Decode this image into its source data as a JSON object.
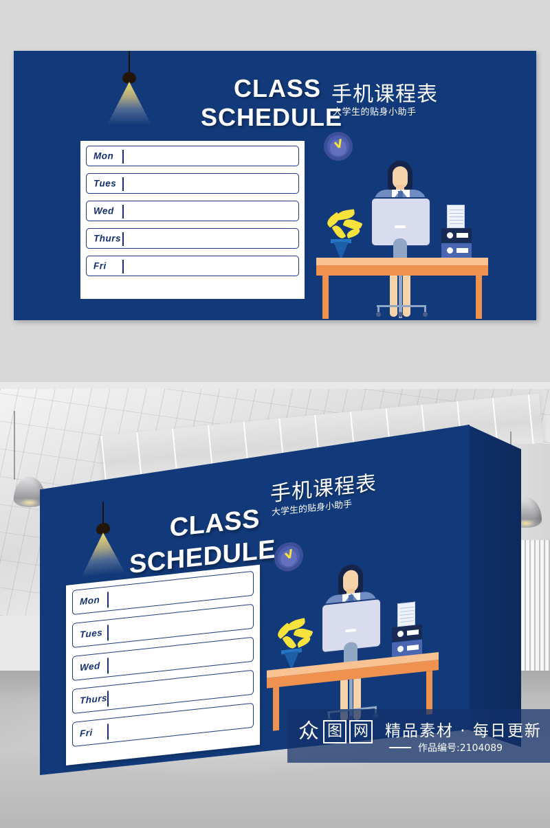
{
  "banner": {
    "english_title_line1": "CLASS",
    "english_title_line2": "SCHEDULE",
    "chinese_title": "手机课程表",
    "chinese_subtitle": "大学生的贴身小助手",
    "background_color": "#123A7A",
    "accent_white": "#FFFFFF",
    "label_color": "#14306E"
  },
  "schedule": {
    "rows": [
      {
        "day": "Mon",
        "value": ""
      },
      {
        "day": "Tues",
        "value": ""
      },
      {
        "day": "Wed",
        "value": ""
      },
      {
        "day": "Thurs",
        "value": ""
      },
      {
        "day": "Fri",
        "value": ""
      }
    ]
  },
  "illustration": {
    "clock": "wall-clock",
    "person": "woman-at-desk",
    "monitor": "desktop-monitor",
    "plant": "potted-plant",
    "binders": "document-binders",
    "desk": "office-desk",
    "chair": "office-chair",
    "lamp": "pendant-lamp"
  },
  "watermark": {
    "logo_chars": [
      "众",
      "图",
      "网"
    ],
    "tagline": "精品素材 · 每日更新",
    "work_id": "作品编号:2104089"
  },
  "scene": {
    "venue": "interior-hall",
    "floor": "concrete-floor",
    "ceiling": "metal-ceiling-panels"
  }
}
